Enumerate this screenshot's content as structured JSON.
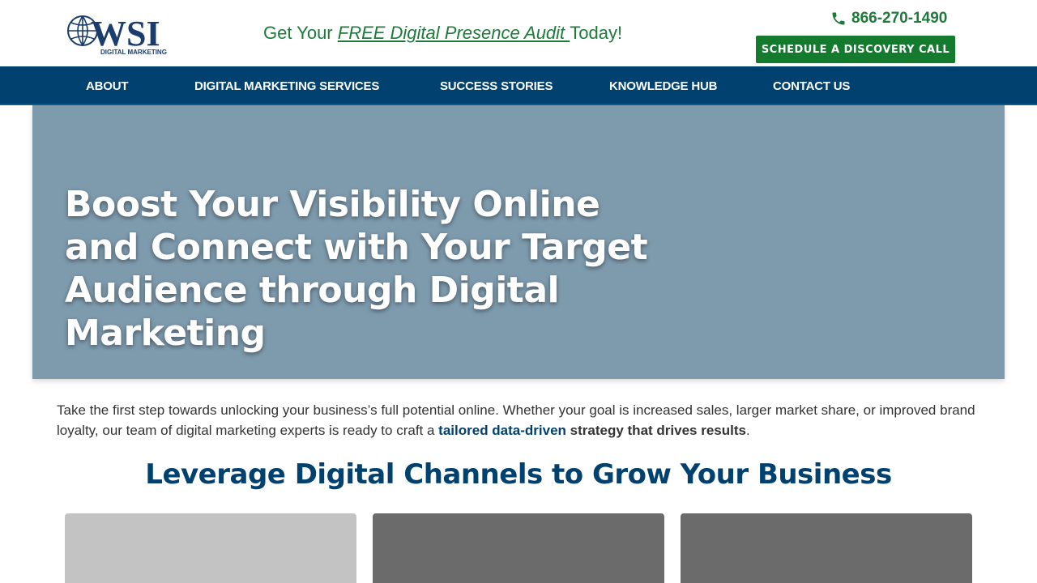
{
  "header": {
    "logo_text": "WSI",
    "logo_subtext": "DIGITAL MARKETING",
    "promo_prefix": "Get Your ",
    "promo_link": "FREE Digital Presence Audit ",
    "promo_suffix": "Today!",
    "phone": "866-270-1490",
    "cta_label": "SCHEDULE A DISCOVERY CALL"
  },
  "nav": {
    "items": [
      {
        "label": "ABOUT"
      },
      {
        "label": "DIGITAL MARKETING SERVICES"
      },
      {
        "label": "SUCCESS STORIES"
      },
      {
        "label": "KNOWLEDGE HUB"
      },
      {
        "label": "CONTACT US"
      }
    ]
  },
  "hero": {
    "title": "Boost Your Visibility Online and Connect with Your Target Audience through Digital Marketing"
  },
  "intro": {
    "text": "Take the first step towards unlocking your business’s full potential online. Whether your goal is increased sales, larger market share, or improved brand loyalty, our team of digital marketing experts is ready to craft a ",
    "link": "tailored data-driven",
    "strong": " strategy that drives results",
    "end": "."
  },
  "section": {
    "title": "Leverage Digital Channels to Grow Your Business"
  },
  "colors": {
    "brand_green": "#137a2e",
    "nav_blue": "#00416f",
    "hero_bg": "#7e9bae"
  }
}
